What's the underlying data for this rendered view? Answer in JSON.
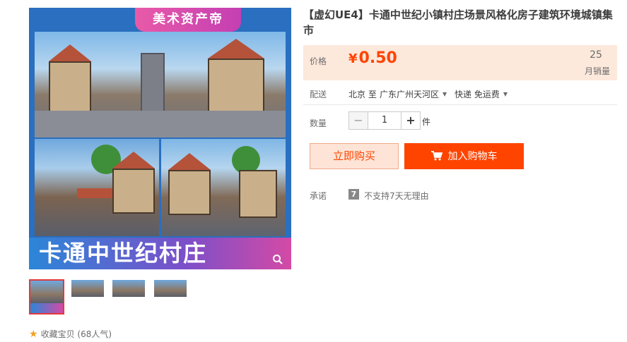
{
  "gallery": {
    "banner_top": "美术资产帝",
    "banner_bottom": "卡通中世纪村庄",
    "zoom_icon": "search-icon",
    "thumbnails_count_label": ""
  },
  "favorite": {
    "icon": "star-icon",
    "label": "收藏宝贝",
    "popularity": "(68人气)"
  },
  "product": {
    "title": "【虚幻UE4】卡通中世纪小镇村庄场景风格化房子建筑环境城镇集市"
  },
  "price": {
    "label": "价格",
    "currency": "¥",
    "value": "0.50",
    "sales_count": "25",
    "sales_label": "月销量"
  },
  "delivery": {
    "label": "配送",
    "from": "北京 至",
    "to": "广东广州天河区",
    "method": "快递 免运费"
  },
  "quantity": {
    "label": "数量",
    "minus": "−",
    "value": "1",
    "plus": "+",
    "unit": "件"
  },
  "actions": {
    "buy_now": "立即购买",
    "add_to_cart": "加入购物车",
    "cart_icon": "cart-icon"
  },
  "promise": {
    "label": "承诺",
    "badge": "7",
    "text": "不支持7天无理由"
  },
  "colors": {
    "accent": "#ff4400",
    "price_bg": "#fde8dc"
  }
}
